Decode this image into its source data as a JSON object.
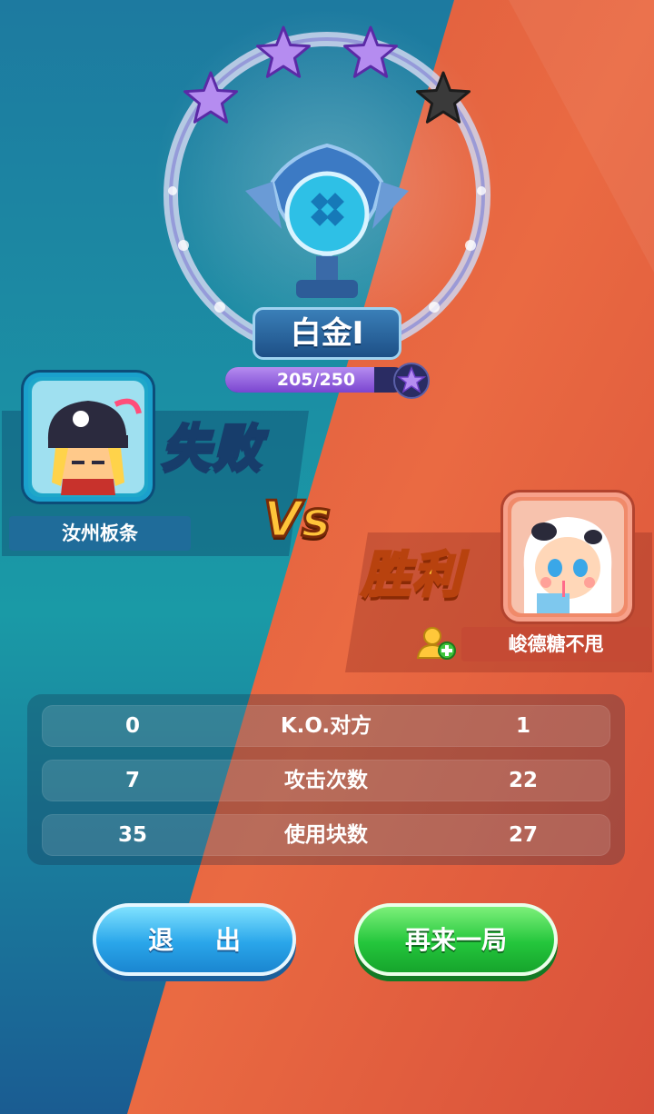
{
  "rank": {
    "name": "白金I",
    "stars_filled": 3,
    "stars_total": 4,
    "progress_text": "205/250",
    "progress_fraction": 0.82
  },
  "players": {
    "left": {
      "name": "汝州板条",
      "result": "失败"
    },
    "right": {
      "name": "峻德糖不甩",
      "result": "胜利"
    }
  },
  "vs_label": "Vs",
  "stats": [
    {
      "left": "0",
      "label": "K.O.对方",
      "right": "1"
    },
    {
      "left": "7",
      "label": "攻击次数",
      "right": "22"
    },
    {
      "left": "35",
      "label": "使用块数",
      "right": "27"
    }
  ],
  "buttons": {
    "exit": "退 出",
    "again": "再来一局"
  },
  "colors": {
    "left_side": "#1f8aa6",
    "right_side": "#e8613f",
    "star_filled": "#b58cf0",
    "star_empty": "#3a3a3a",
    "exit_button": "#2aa6ea",
    "again_button": "#24c63c"
  },
  "icons": {
    "star": "star-icon",
    "add_friend": "add-friend-icon",
    "trophy": "platinum-trophy-icon"
  }
}
